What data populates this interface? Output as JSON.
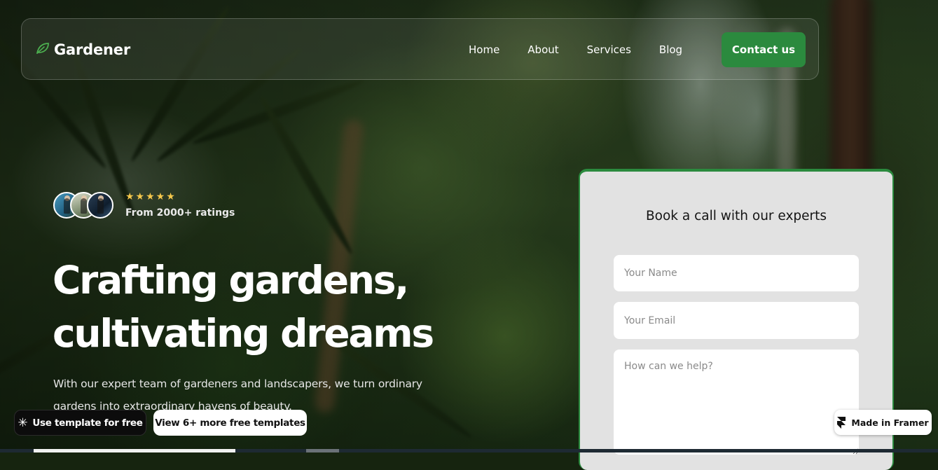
{
  "nav": {
    "brand": "Gardener",
    "links": [
      "Home",
      "About",
      "Services",
      "Blog"
    ],
    "cta": "Contact us"
  },
  "hero": {
    "stars": "★★★★★",
    "rating_value": 5,
    "rating_label": "From 2000+ ratings",
    "headline_line1": "Crafting gardens,",
    "headline_line2": "cultivating dreams",
    "subtext": "With our expert team of gardeners and landscapers, we turn ordinary gardens into extraordinary havens of beauty."
  },
  "form": {
    "title": "Book a call with our experts",
    "name_placeholder": "Your Name",
    "email_placeholder": "Your Email",
    "message_placeholder": "How can we help?"
  },
  "overlays": {
    "use_template": "Use template for free",
    "more_templates": "View 6+ more free templates",
    "framer_badge": "Made in Framer"
  },
  "colors": {
    "accent": "#2b8a3e",
    "star": "#f6c84c",
    "form_bg": "#e2e2e2"
  },
  "icons": {
    "brand": "leaf-icon",
    "framer": "framer-logo-icon",
    "template": "asterisk-icon"
  }
}
